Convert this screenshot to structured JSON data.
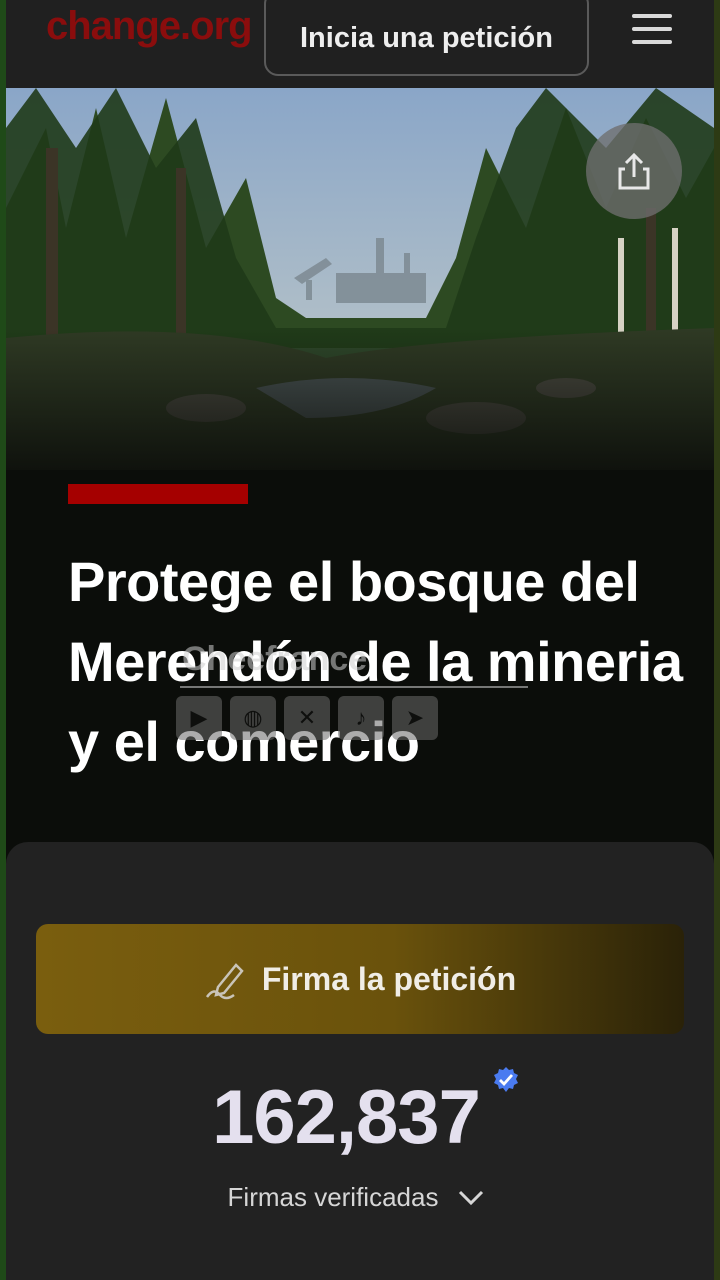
{
  "header": {
    "logo_text": "change.org",
    "start_petition_label": "Inicia una petición",
    "menu_icon": "hamburger-menu-icon"
  },
  "hero": {
    "share_icon": "share-icon"
  },
  "petition": {
    "title": "Protege el bosque del Merendón de la mineria y el comercio"
  },
  "watermark": {
    "name": "Cheefrance",
    "icons": [
      "youtube-icon",
      "globe-icon",
      "x-icon",
      "tiktok-icon",
      "telegram-icon"
    ]
  },
  "signature": {
    "button_label": "Firma la petición",
    "count": "162,837",
    "verified_label": "Firmas verificadas"
  },
  "colors": {
    "brand_red": "#a50000",
    "sign_button": "#7a5e0e",
    "verified_badge": "#4a7bf0"
  }
}
